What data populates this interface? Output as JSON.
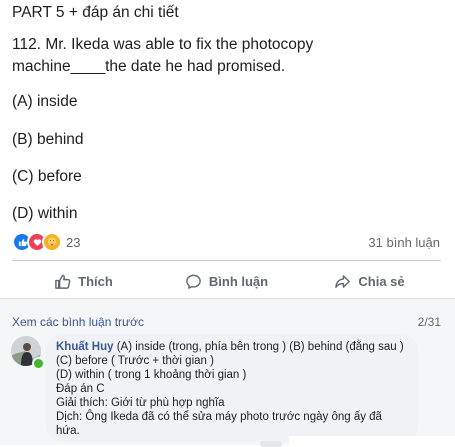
{
  "post": {
    "lines": [
      "PART 5 + đáp án chi tiết",
      "112.  Mr. Ikeda was able to fix the photocopy",
      "machine____the date he had promised.",
      "(A)  inside",
      "(B)  behind",
      "(C)  before",
      "(D)  within"
    ],
    "reaction_count": "23",
    "comment_count": "31 bình luận",
    "reaction_icons": [
      "like-icon",
      "love-icon",
      "care-icon"
    ]
  },
  "actions": {
    "like": "Thích",
    "comment": "Bình luận",
    "share": "Chia sẻ"
  },
  "comments": {
    "see_more": "Xem các bình luận trước",
    "pager": "2/31",
    "items": [
      {
        "author": "Khuất Huy",
        "first_line": " (A) inside (trong, phía bên trong ) (B) behind (đằng sau )",
        "lines": [
          "(C) before ( Trước + thời gian )",
          "(D) within ( trong 1 khoảng thời gian )",
          "Đáp án C",
          "Giải thích: Giới từ phù hợp nghĩa",
          "Dịch: Ông Ikeda đã có thể sửa máy photo trước ngày ông ấy đã",
          "hứa."
        ]
      }
    ]
  },
  "colors": {
    "link": "#385898",
    "like_blue": "#1877f2",
    "love_red": "#f33e58",
    "care_yellow": "#f7b125",
    "online_green": "#42b72a"
  }
}
